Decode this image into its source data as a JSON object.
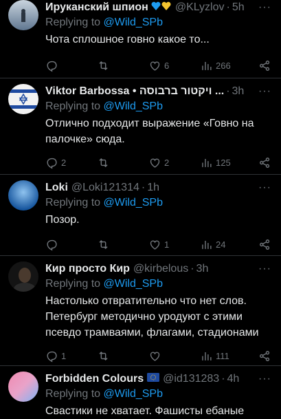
{
  "tweets": [
    {
      "name": "Ируканский шпион",
      "badge": "blue-heart-yellow-heart",
      "handle": "@KLyzlov",
      "time": "5h",
      "replying_prefix": "Replying to ",
      "replying_to": "@Wild_SPb",
      "text": "Чота сплошное говно какое то...",
      "reply_count": "",
      "retweet_count": "",
      "like_count": "6",
      "view_count": "266",
      "avatar_colors": [
        "#7a8fa8",
        "#c9d4de"
      ]
    },
    {
      "name": "Viktor Barbossa • ויקטור ברבוסה ...",
      "handle": "",
      "time": "3h",
      "replying_prefix": "Replying to ",
      "replying_to": "@Wild_SPb",
      "text": "Отлично подходит выражение «Говно на палочке» сюда.",
      "reply_count": "2",
      "retweet_count": "",
      "like_count": "2",
      "view_count": "125",
      "avatar_colors": [
        "#1e4aa0",
        "#f2f2f2"
      ]
    },
    {
      "name": "Loki",
      "handle": "@Loki121314",
      "time": "1h",
      "replying_prefix": "Replying to ",
      "replying_to": "@Wild_SPb",
      "text": "Позор.",
      "reply_count": "",
      "retweet_count": "",
      "like_count": "1",
      "view_count": "24",
      "avatar_colors": [
        "#1a6fc2",
        "#8fc3ef"
      ]
    },
    {
      "name": "Кир просто Кир",
      "handle": "@kirbelous",
      "time": "3h",
      "replying_prefix": "Replying to ",
      "replying_to": "@Wild_SPb",
      "text": "Настолько отвратительно что нет слов. Петербург методично уродуют с этими псевдо трамваями, флагами, стадионами",
      "reply_count": "1",
      "retweet_count": "",
      "like_count": "",
      "view_count": "111",
      "avatar_colors": [
        "#1a1a1a",
        "#5a4a3a"
      ]
    },
    {
      "name": "Forbidden Colours",
      "badge": "eu-flag",
      "handle": "@id131283",
      "time": "4h",
      "replying_prefix": "Replying to ",
      "replying_to": "@Wild_SPb",
      "text": "Свастики не хватает. Фашисты ебаные",
      "avatar_colors": [
        "#f08ab0",
        "#7fb3f5"
      ]
    }
  ],
  "icons": {
    "reply": "reply-icon",
    "retweet": "retweet-icon",
    "like": "heart-icon",
    "views": "views-icon",
    "share": "share-icon",
    "menu": "more-icon"
  },
  "colors": {
    "background": "#000000",
    "text": "#e7e9ea",
    "muted": "#71767b",
    "link": "#1d9bf0",
    "divider": "#2f3336"
  }
}
